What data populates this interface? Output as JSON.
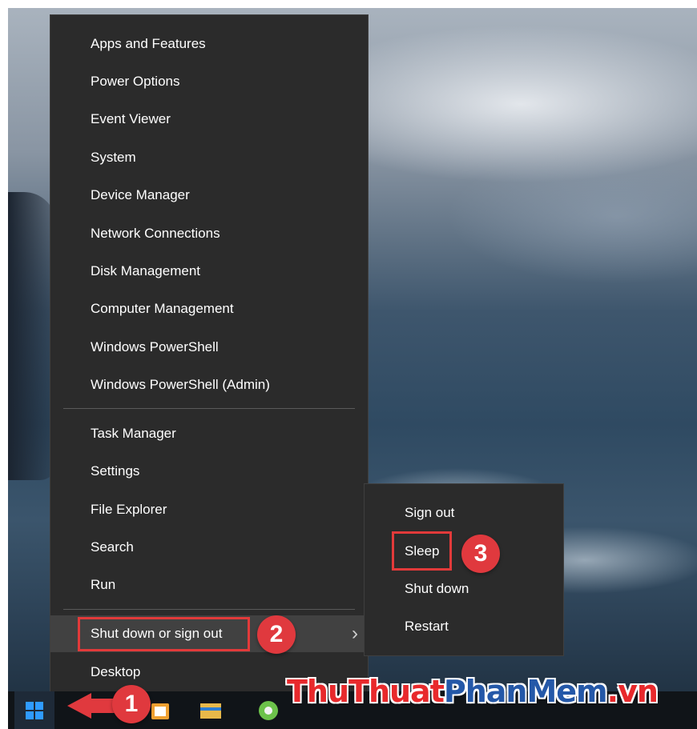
{
  "context_menu": {
    "items": [
      {
        "label": "Apps and Features"
      },
      {
        "label": "Power Options"
      },
      {
        "label": "Event Viewer"
      },
      {
        "label": "System"
      },
      {
        "label": "Device Manager"
      },
      {
        "label": "Network Connections"
      },
      {
        "label": "Disk Management"
      },
      {
        "label": "Computer Management"
      },
      {
        "label": "Windows PowerShell"
      },
      {
        "label": "Windows PowerShell (Admin)"
      },
      {
        "label": "Task Manager"
      },
      {
        "label": "Settings"
      },
      {
        "label": "File Explorer"
      },
      {
        "label": "Search"
      },
      {
        "label": "Run"
      },
      {
        "label": "Shut down or sign out"
      },
      {
        "label": "Desktop"
      }
    ],
    "highlighted_item": "Shut down or sign out"
  },
  "submenu": {
    "items": [
      {
        "label": "Sign out"
      },
      {
        "label": "Sleep"
      },
      {
        "label": "Shut down"
      },
      {
        "label": "Restart"
      }
    ],
    "highlighted_item": "Sleep"
  },
  "annotations": {
    "step1": "1",
    "step2": "2",
    "step3": "3"
  },
  "watermark": {
    "part1": "ThuThuat",
    "part2": "PhanMem",
    "part3": ".vn"
  },
  "icons": {
    "start": "windows-start-icon",
    "chevron": "chevron-right-icon"
  },
  "colors": {
    "menu_bg": "#2b2b2b",
    "menu_hover": "#414141",
    "annotation_red": "#e0393e",
    "watermark_red": "#e8292c",
    "watermark_blue": "#2458a8"
  }
}
